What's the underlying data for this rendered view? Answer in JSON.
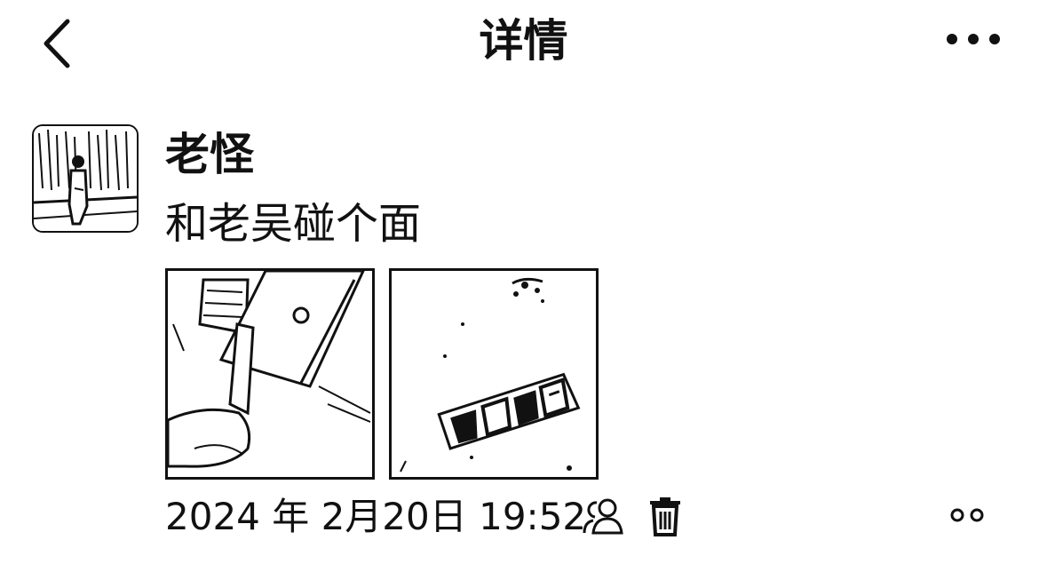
{
  "header": {
    "title": "详情",
    "back_icon": "chevron-left-icon",
    "more_icon": "ellipsis-icon"
  },
  "post": {
    "username": "老怪",
    "text": "和老吴碰个面",
    "timestamp": "2024 年 2月20日 19:52",
    "photos": [
      {
        "alt": "photo-of-hand-at-door"
      },
      {
        "alt": "photo-of-storefront-sign"
      }
    ],
    "visibility_icon": "friends-icon",
    "delete_icon": "trash-icon",
    "action_icon": "two-dots-icon"
  },
  "colors": {
    "text": "#111111",
    "background": "#ffffff"
  }
}
